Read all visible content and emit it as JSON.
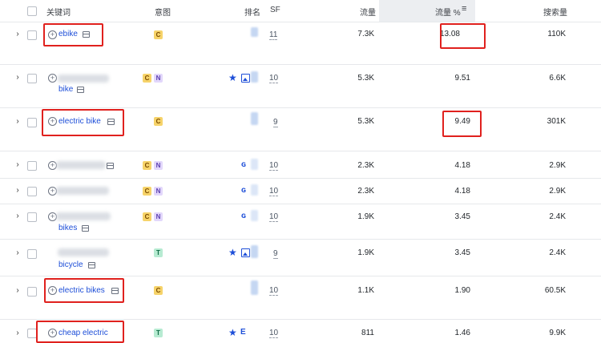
{
  "header": {
    "keyword": "关键词",
    "intent": "意图",
    "position": "排名",
    "sf": "SF",
    "traffic": "流量",
    "traffic_pct": "流量 %",
    "volume": "搜索量"
  },
  "colors": {
    "highlight": "#e0211e",
    "link": "#1d4ed8",
    "sorted_column_bg": "#eceef1"
  },
  "rows": [
    {
      "keyword": "ebike",
      "keyword_line2": "",
      "intents": [
        "C"
      ],
      "sf": "11",
      "traffic": "7.3K",
      "traffic_pct": "13.08",
      "volume": "110K"
    },
    {
      "keyword": "",
      "keyword_line2": "bike",
      "intents": [
        "C",
        "N"
      ],
      "sf": "10",
      "traffic": "5.3K",
      "traffic_pct": "9.51",
      "volume": "6.6K"
    },
    {
      "keyword": "electric bike",
      "keyword_line2": "",
      "intents": [
        "C"
      ],
      "sf": "9",
      "traffic": "5.3K",
      "traffic_pct": "9.49",
      "volume": "301K"
    },
    {
      "keyword": "",
      "keyword_line2": "",
      "intents": [
        "C",
        "N"
      ],
      "sf": "10",
      "traffic": "2.3K",
      "traffic_pct": "4.18",
      "volume": "2.9K"
    },
    {
      "keyword": "",
      "keyword_line2": "",
      "intents": [
        "C",
        "N"
      ],
      "sf": "10",
      "traffic": "2.3K",
      "traffic_pct": "4.18",
      "volume": "2.9K"
    },
    {
      "keyword": "",
      "keyword_line2": "bikes",
      "intents": [
        "C",
        "N"
      ],
      "sf": "10",
      "traffic": "1.9K",
      "traffic_pct": "3.45",
      "volume": "2.4K"
    },
    {
      "keyword": "",
      "keyword_line2": "bicycle",
      "intents": [
        "T"
      ],
      "sf": "9",
      "traffic": "1.9K",
      "traffic_pct": "3.45",
      "volume": "2.4K"
    },
    {
      "keyword": "electric bikes",
      "keyword_line2": "",
      "intents": [
        "C"
      ],
      "sf": "10",
      "traffic": "1.1K",
      "traffic_pct": "1.90",
      "volume": "60.5K"
    },
    {
      "keyword": "cheap electric",
      "keyword_line2": "",
      "intents": [
        "T"
      ],
      "sf": "10",
      "traffic": "811",
      "traffic_pct": "1.46",
      "volume": "9.9K"
    }
  ]
}
